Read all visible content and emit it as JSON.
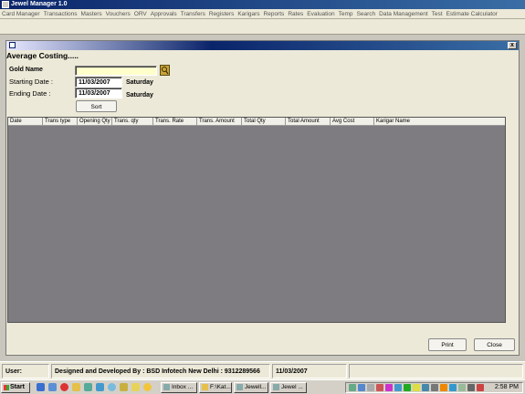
{
  "app": {
    "title": "Jewel Manager 1.0"
  },
  "menu": [
    "Card Manager",
    "Transactions",
    "Masters",
    "Vouchers",
    "ORV",
    "Approvals",
    "Transfers",
    "Registers",
    "Karigars",
    "Reports",
    "Rates",
    "Evaluation",
    "Temp",
    "Search",
    "Data Management",
    "Test",
    "Estimate Calculator"
  ],
  "window": {
    "heading": "Average Costing.....",
    "close_glyph": "x",
    "gold_name_label": "Gold Name",
    "gold_name_value": "",
    "starting_date_label": "Starting Date  :",
    "starting_date_value": "11/03/2007",
    "starting_day": "Saturday",
    "ending_date_label": "Ending Date   :",
    "ending_date_value": "11/03/2007",
    "ending_day": "Saturday",
    "sort_label": "Sort",
    "print_label": "Print",
    "close_label": "Close"
  },
  "grid": {
    "columns": [
      "Date",
      "Trans type",
      "Opening Qty",
      "Trans. qty",
      "Trans. Rate",
      "Trans. Amount",
      "Total Qty",
      "Total Amount",
      "Avg Cost",
      "Karigar Name"
    ],
    "rows": []
  },
  "statusbar": {
    "user": "User:",
    "credit": "Designed and Developed By : BSD Infotech New Delhi : 9312289566",
    "date": "11/03/2007"
  },
  "taskbar": {
    "start": "Start",
    "tasks": [
      "Inbox ...",
      "F:\\Kat...",
      "Jewell...",
      "Jewel ..."
    ],
    "clock": "2:58 PM"
  },
  "colors": {
    "titlebar": "#0a246a",
    "grid_bg": "#7e7c80",
    "gold_input": "#ffffcc"
  }
}
